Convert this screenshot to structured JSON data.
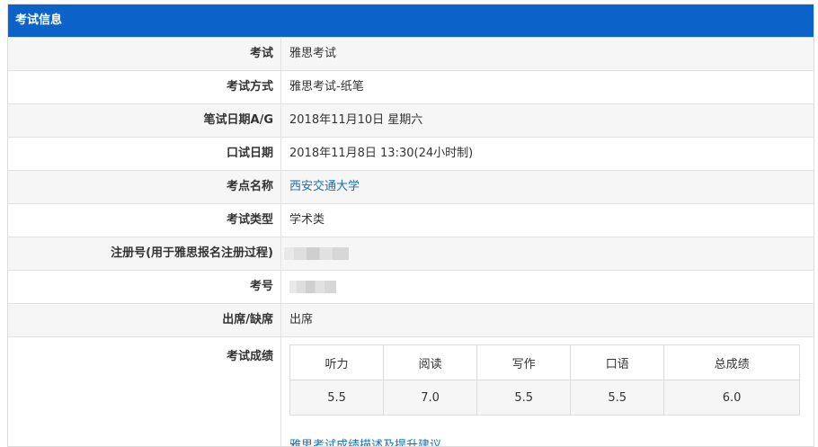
{
  "panel": {
    "title": "考试信息"
  },
  "rows": [
    {
      "label": "考试",
      "value": "雅思考试"
    },
    {
      "label": "考试方式",
      "value": "雅思考试-纸笔"
    },
    {
      "label": "笔试日期A/G",
      "value": "2018年11月10日 星期六"
    },
    {
      "label": "口试日期",
      "value": "2018年11月8日 13:30(24小时制)"
    },
    {
      "label": "考点名称",
      "value": "西安交通大学"
    },
    {
      "label": "考试类型",
      "value": "学术类"
    },
    {
      "label": "注册号(用于雅思报名注册过程)",
      "value": ""
    },
    {
      "label": "考号",
      "value": ""
    },
    {
      "label": "出席/缺席",
      "value": "出席"
    }
  ],
  "scores": {
    "label": "考试成绩",
    "headers": [
      "听力",
      "阅读",
      "写作",
      "口语",
      "总成绩"
    ],
    "values": [
      "5.5",
      "7.0",
      "5.5",
      "5.5",
      "6.0"
    ],
    "link": "雅思考试成绩描述及提升建议"
  },
  "colors": {
    "header_bg": "#0b63c9",
    "link": "#1a6fb3"
  }
}
